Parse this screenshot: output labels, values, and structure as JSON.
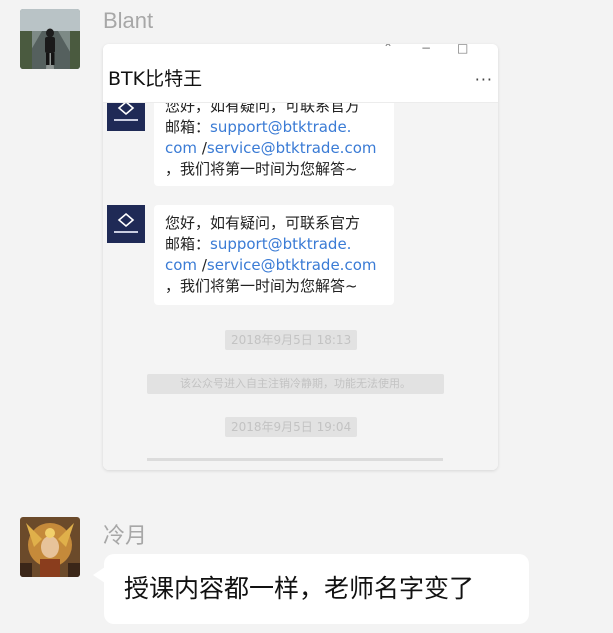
{
  "messages": [
    {
      "sender": "Blant",
      "avatar_icon": "person-on-road-avatar",
      "card": {
        "title": "BTK比特王",
        "more_label": "···",
        "window_controls": [
          "⌃",
          "−",
          "□"
        ],
        "entries": [
          {
            "logo_text": "BTKTRADE",
            "line1_prefix": "您好，如有疑问，可联系官方",
            "line2_prefix": "邮箱：",
            "email1_a": "support@btktrade.",
            "email1_b": "com",
            "sep": " /",
            "email2": "service@btktrade.com",
            "line_end": "，我们将第一时间为您解答~"
          },
          {
            "logo_text": "BTKTRADE",
            "line1_prefix": "您好，如有疑问，可联系官方",
            "line2_prefix": "邮箱：",
            "email1_a": "support@btktrade.",
            "email1_b": "com",
            "sep": " /",
            "email2": "service@btktrade.com",
            "line_end": "，我们将第一时间为您解答~"
          }
        ],
        "system": [
          "2018年9月5日 18:13",
          "该公众号进入自主注销冷静期，功能无法使用。",
          "2018年9月5日 19:04"
        ]
      }
    },
    {
      "sender": "冷月",
      "avatar_icon": "warrior-avatar",
      "text": "授课内容都一样，老师名字变了"
    }
  ],
  "colors": {
    "background": "#f3f3f3",
    "link": "#3a7bd5",
    "logo_bg": "#1f2a56",
    "sender_name": "#a7a7a7"
  }
}
